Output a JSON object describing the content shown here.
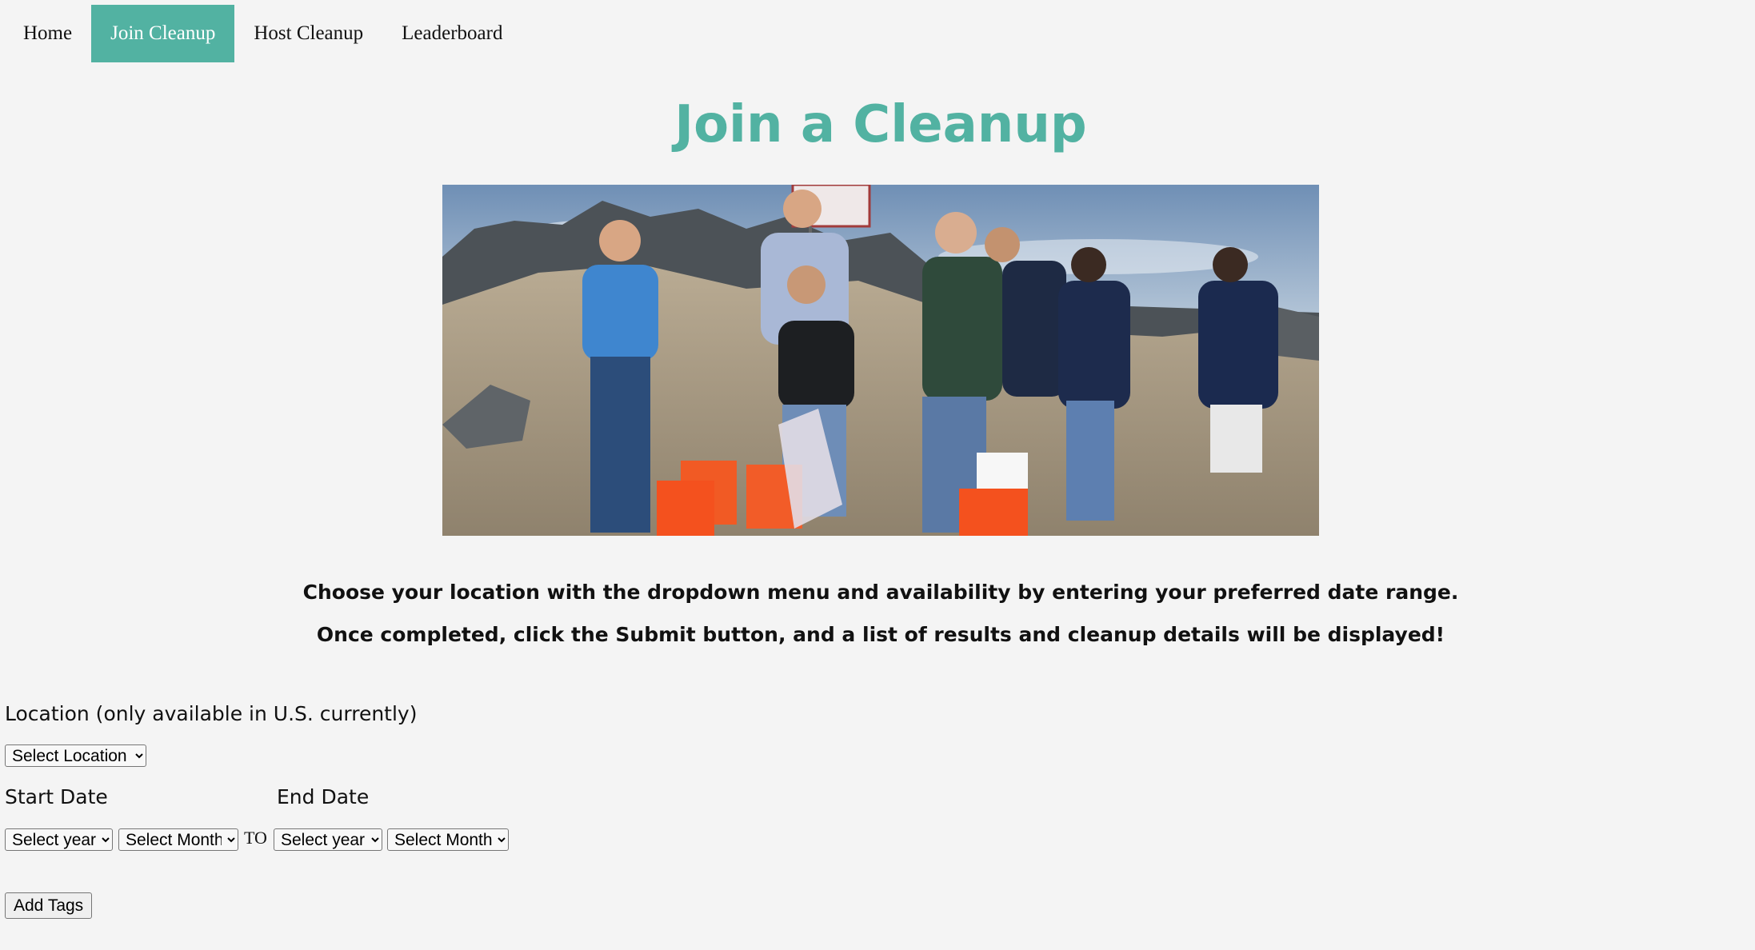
{
  "nav": {
    "items": [
      {
        "label": "Home"
      },
      {
        "label": "Join Cleanup"
      },
      {
        "label": "Host Cleanup"
      },
      {
        "label": "Leaderboard"
      }
    ],
    "active_color": "#52b2a2"
  },
  "main": {
    "title": "Join a Cleanup",
    "hero_image": "group-of-volunteers-on-beach-with-orange-buckets",
    "instructions": [
      "Choose your location with the dropdown menu and availability by entering your preferred date range.",
      "Once completed, click the Submit button, and a list of results and cleanup details will be displayed!"
    ]
  },
  "form": {
    "location_label": "Location (only available in U.S. currently)",
    "location_select": "Select Location",
    "start_date_label": "Start Date",
    "end_date_label": "End Date",
    "start_year": "Select year",
    "start_month": "Select Month",
    "to_text": "TO",
    "end_year": "Select year",
    "end_month": "Select Month",
    "add_tags_label": "Add Tags"
  }
}
